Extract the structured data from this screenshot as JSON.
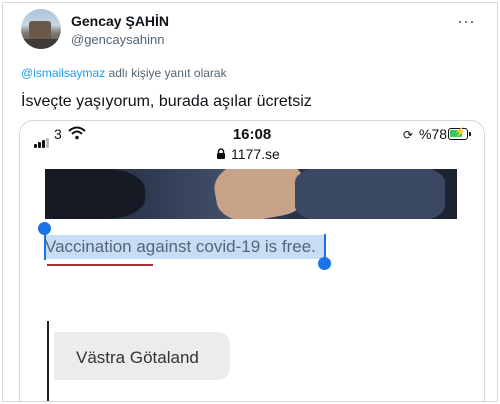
{
  "tweet": {
    "author_name": "Gencay ŞAHİN",
    "author_handle": "@gencaysahinn",
    "more_label": "···",
    "reply_mention": "@ismailsaymaz",
    "reply_suffix": " adlı kişiye yanıt olarak",
    "text": "İsveçte yaşıyorum, burada aşılar ücretsiz"
  },
  "screenshot": {
    "status_bar": {
      "carrier": "3",
      "time": "16:08",
      "url": "1177.se",
      "battery_text": "%78",
      "battery_level": 0.78
    },
    "selected_text": "Vaccination against covid-19 is free.",
    "region_button": "Västra Götaland"
  },
  "icons": {
    "avatar": "avatar-photo",
    "signal": "signal-icon",
    "wifi": "wifi-icon",
    "lock": "lock-icon",
    "rotation_lock": "rotation-lock-icon",
    "battery": "battery-icon"
  },
  "colors": {
    "mention": "#1d9bf0",
    "handle": "#536471",
    "selection": "#c8dcf5",
    "selection_handle": "#1a73e8",
    "battery_fill": "#34c759"
  }
}
